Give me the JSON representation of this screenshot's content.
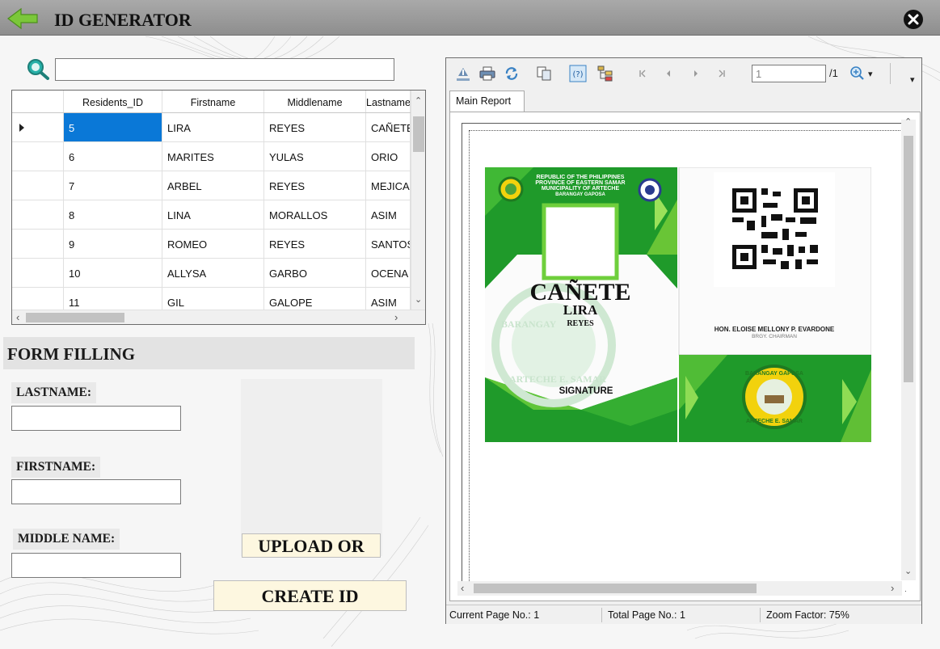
{
  "app": {
    "title": "ID GENERATOR"
  },
  "search": {
    "value": "",
    "placeholder": ""
  },
  "residents_table": {
    "columns": [
      "Residents_ID",
      "Firstname",
      "Middlename",
      "Lastname"
    ],
    "rows": [
      {
        "id": "5",
        "firstname": "LIRA",
        "middlename": "REYES",
        "lastname": "CAÑETE"
      },
      {
        "id": "6",
        "firstname": "MARITES",
        "middlename": "YULAS",
        "lastname": "ORIO"
      },
      {
        "id": "7",
        "firstname": "ARBEL",
        "middlename": "REYES",
        "lastname": "MEJICA"
      },
      {
        "id": "8",
        "firstname": "LINA",
        "middlename": "MORALLOS",
        "lastname": "ASIM"
      },
      {
        "id": "9",
        "firstname": "ROMEO",
        "middlename": "REYES",
        "lastname": "SANTOS"
      },
      {
        "id": "10",
        "firstname": "ALLYSA",
        "middlename": "GARBO",
        "lastname": "OCENA"
      },
      {
        "id": "11",
        "firstname": "GIL",
        "middlename": "GALOPE",
        "lastname": "ASIM"
      }
    ],
    "selected_row": 0
  },
  "form": {
    "header": "FORM FILLING",
    "lastname_label": "LASTNAME:",
    "firstname_label": "FIRSTNAME:",
    "middlename_label": "MIDDLE NAME:",
    "lastname_value": "",
    "firstname_value": "",
    "middlename_value": "",
    "upload_button": "UPLOAD OR",
    "create_button": "CREATE ID"
  },
  "report_viewer": {
    "page_input": "1",
    "page_total": "/1",
    "tab": "Main Report",
    "status": {
      "current_page": "Current Page No.: 1",
      "total_page": "Total Page No.: 1",
      "zoom": "Zoom Factor: 75%"
    }
  },
  "id_card": {
    "header_lines": [
      "REPUBLIC OF THE PHILIPPINES",
      "PROVINCE OF EASTERN SAMAR",
      "MUNICIPALITY OF ARTECHE",
      "BARANGAY GAPOSA"
    ],
    "lastname": "CAÑETE",
    "firstname": "LIRA",
    "middlename": "REYES",
    "signature_label": "SIGNATURE",
    "official_name": "HON. ELOISE MELLONY P. EVARDONE",
    "official_role": "BRGY. CHAIRMAN",
    "seal_top": "BARANGAY GAPOSA",
    "seal_bottom": "ARTECHE E. SAMAR",
    "watermark_top": "BARANGAY",
    "watermark_bottom": "ARTECHE E. SAMAR"
  },
  "colors": {
    "titlebar": "#9b9b9b",
    "card_green": "#1f9a2a",
    "card_light_green": "#7ccf3a",
    "button_bg": "#fdf7e0",
    "selection": "#0a78d7"
  },
  "icons": [
    "back-arrow-icon",
    "close-icon",
    "search-icon",
    "export-icon",
    "print-icon",
    "refresh-icon",
    "copy-icon",
    "help-icon",
    "group-tree-icon",
    "first-page-icon",
    "prev-page-icon",
    "next-page-icon",
    "last-page-icon",
    "zoom-icon"
  ]
}
